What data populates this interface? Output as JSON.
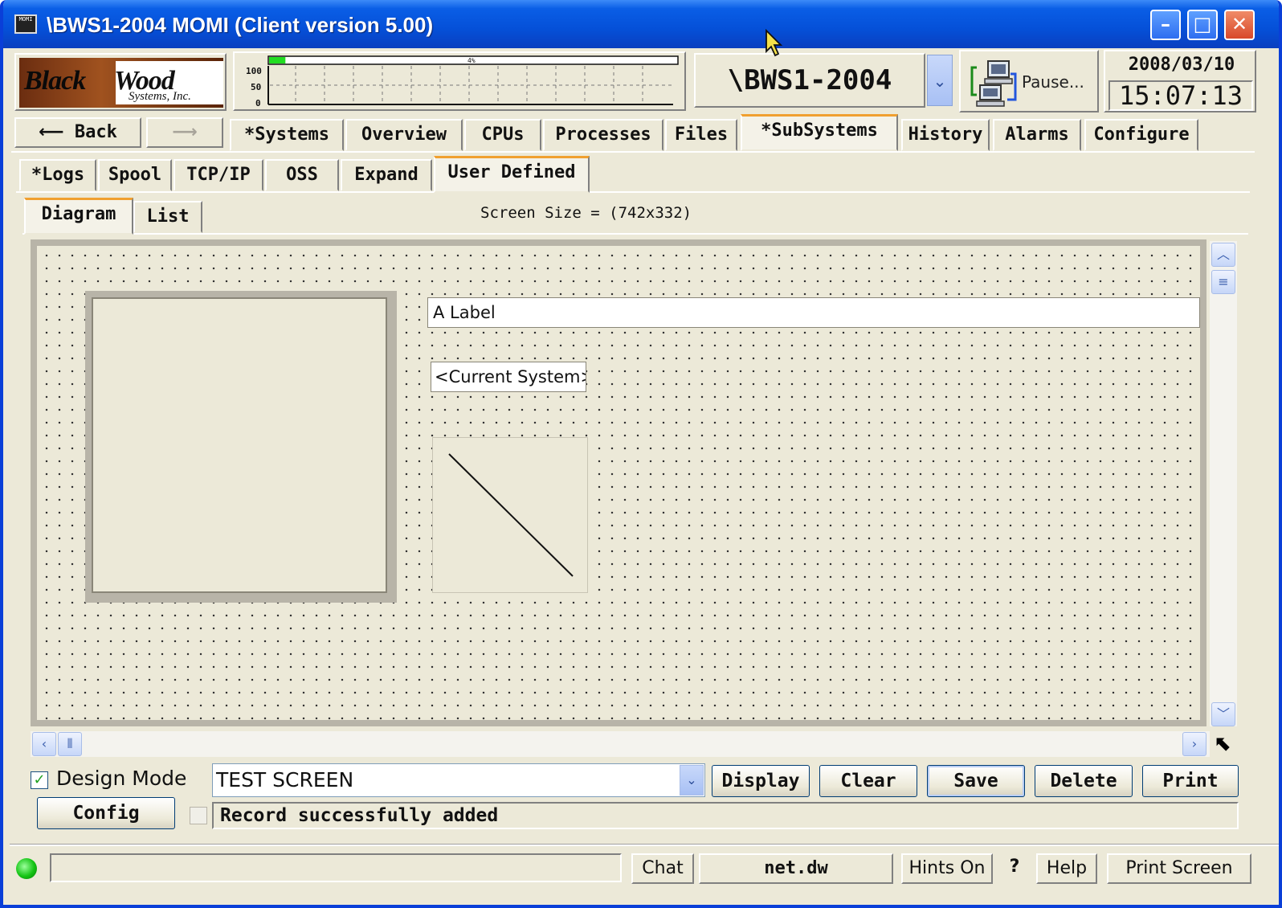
{
  "window": {
    "title": "\\BWS1-2004 MOMI (Client version 5.00)",
    "icon_text": "MOMI"
  },
  "logo": {
    "word1": "Black",
    "word2": "Wood",
    "sub": "Systems, Inc."
  },
  "gauge": {
    "ticks": [
      "100",
      "50",
      "0"
    ],
    "percent_label": "4%",
    "percent": 4
  },
  "system": {
    "name": "\\BWS1-2004"
  },
  "pause": {
    "label": "Pause..."
  },
  "datetime": {
    "date": "2008/03/10",
    "time": "15:07:13"
  },
  "nav": {
    "back": "Back"
  },
  "main_tabs": [
    "*Systems",
    "Overview",
    "CPUs",
    "Processes",
    "Files",
    "*SubSystems",
    "History",
    "Alarms",
    "Configure"
  ],
  "sub_tabs": [
    "*Logs",
    "Spool",
    "TCP/IP",
    "OSS",
    "Expand",
    "User Defined"
  ],
  "view_tabs": [
    "Diagram",
    "List"
  ],
  "screen_size": "Screen Size = (742x332)",
  "canvas": {
    "label_text": "A Label",
    "system_text": "<Current System>"
  },
  "controls": {
    "design_mode": "Design Mode",
    "screen_name": "TEST SCREEN",
    "buttons": [
      "Display",
      "Clear",
      "Save",
      "Delete",
      "Print"
    ],
    "config": "Config",
    "status_message": "Record successfully added"
  },
  "statusbar": {
    "chat": "Chat",
    "user": "net.dw",
    "hints": "Hints On",
    "question": "?",
    "help": "Help",
    "print_screen": "Print Screen"
  },
  "colors": {
    "title_blue": "#0550d8",
    "face": "#ece9d8",
    "tab_active_accent": "#f0a030",
    "led_green": "#14c414"
  }
}
